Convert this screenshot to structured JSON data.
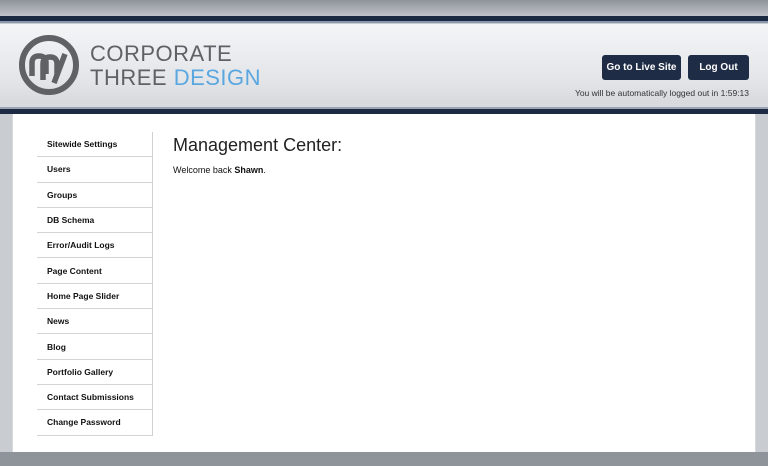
{
  "brand": {
    "line1": "CORPORATE",
    "line2_a": "THREE",
    "line2_b": "DESIGN",
    "accent_color": "#5aa7e0",
    "icon": "corporate-three-design-logo"
  },
  "header": {
    "live_site_label": "Go to Live Site",
    "logout_label": "Log Out",
    "timer_text": "You will be automatically logged out in 1:59:13"
  },
  "colors": {
    "navy": "#1f2c46",
    "content_bg": "#ffffff"
  },
  "sidebar": {
    "items": [
      {
        "label": "Sitewide Settings"
      },
      {
        "label": "Users"
      },
      {
        "label": "Groups"
      },
      {
        "label": "DB Schema"
      },
      {
        "label": "Error/Audit Logs"
      },
      {
        "label": "Page Content"
      },
      {
        "label": "Home Page Slider"
      },
      {
        "label": "News"
      },
      {
        "label": "Blog"
      },
      {
        "label": "Portfolio Gallery"
      },
      {
        "label": "Contact Submissions"
      },
      {
        "label": "Change Password"
      }
    ]
  },
  "main": {
    "title": "Management Center:",
    "welcome_prefix": "Welcome back ",
    "username": "Shawn",
    "welcome_suffix": "."
  }
}
